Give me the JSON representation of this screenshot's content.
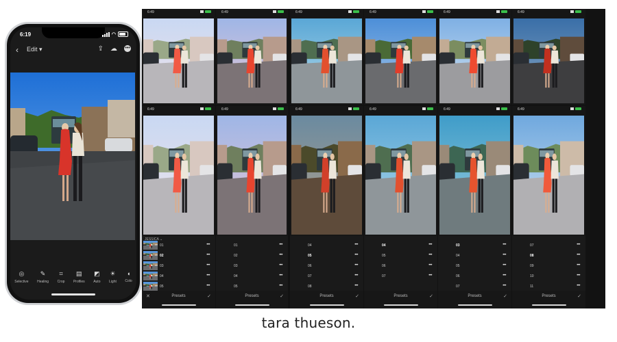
{
  "phone": {
    "time": "6:19",
    "topbar": {
      "back_label": "‹",
      "edit_label": "Edit ▾"
    },
    "tools": [
      {
        "icon": "selective-icon",
        "glyph": "◎",
        "label": "Selective"
      },
      {
        "icon": "healing-icon",
        "glyph": "✎",
        "label": "Healing"
      },
      {
        "icon": "crop-icon",
        "glyph": "⌗",
        "label": "Crop"
      },
      {
        "icon": "profiles-icon",
        "glyph": "▤",
        "label": "Profiles"
      },
      {
        "icon": "auto-icon",
        "glyph": "◩",
        "label": "Auto"
      },
      {
        "icon": "light-icon",
        "glyph": "☀",
        "label": "Light"
      },
      {
        "icon": "color-icon",
        "glyph": "◖",
        "label": "Colo"
      }
    ]
  },
  "gallery": {
    "time_top": "6:49",
    "time_bottom": "6:49",
    "category_label": "JESSICA ⌄",
    "footer_label": "Presets",
    "shots_top": [
      {
        "theme": "bright-pink"
      },
      {
        "theme": "pink-warm"
      },
      {
        "theme": "teal-cool"
      },
      {
        "theme": "natural"
      },
      {
        "theme": "bright"
      },
      {
        "theme": "moody-dark"
      }
    ],
    "shots_bottom": [
      {
        "theme": "bright-pink"
      },
      {
        "theme": "pink-warm"
      },
      {
        "theme": "brown-warm"
      },
      {
        "theme": "teal-cool"
      },
      {
        "theme": "teal-strong"
      },
      {
        "theme": "bright-clean"
      }
    ],
    "panels": [
      {
        "show_x": true,
        "show_swatch": true,
        "rows": [
          "01",
          "02",
          "03",
          "04",
          "05"
        ],
        "selected": "02"
      },
      {
        "show_x": false,
        "show_swatch": false,
        "rows": [
          "01",
          "02",
          "03",
          "04",
          "05"
        ],
        "selected": ""
      },
      {
        "show_x": false,
        "show_swatch": false,
        "rows": [
          "04",
          "05",
          "06",
          "07",
          "08"
        ],
        "selected": "05"
      },
      {
        "show_x": false,
        "show_swatch": false,
        "rows": [
          "04",
          "05",
          "06",
          "07"
        ],
        "selected": "04"
      },
      {
        "show_x": false,
        "show_swatch": false,
        "rows": [
          "03",
          "04",
          "05",
          "06",
          "07"
        ],
        "selected": "03"
      },
      {
        "show_x": false,
        "show_swatch": false,
        "rows": [
          "07",
          "08",
          "09",
          "10",
          "11"
        ],
        "selected": "08"
      }
    ]
  },
  "caption": "tara thueson."
}
